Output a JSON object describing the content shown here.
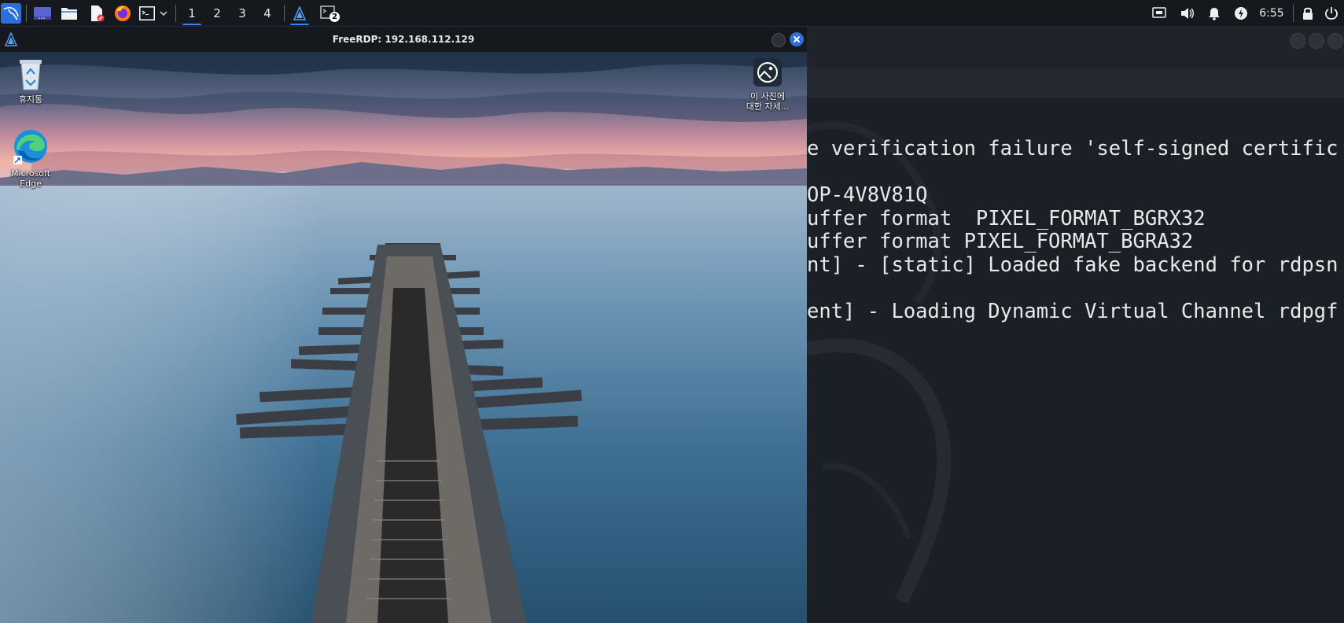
{
  "taskbar": {
    "workspaces": [
      "1",
      "2",
      "3",
      "4"
    ],
    "active_workspace": "1",
    "terminal_badge": "2",
    "clock": "6:55",
    "icons": [
      "kali-menu-icon",
      "show-desktop-icon",
      "file-manager-icon",
      "text-editor-icon",
      "firefox-icon",
      "terminal-icon",
      "chevron-down-icon",
      "freerdp-task-icon",
      "terminal-task-icon",
      "display-icon",
      "volume-icon",
      "notification-bell-icon",
      "power-manager-icon",
      "lock-icon",
      "power-icon"
    ]
  },
  "rdp_window": {
    "title": "FreeRDP: 192.168.112.129",
    "desktop_icons": [
      {
        "name": "recycle-bin",
        "label": "휴지통"
      },
      {
        "name": "microsoft-edge",
        "label_line1": "Microsoft",
        "label_line2": "Edge"
      },
      {
        "name": "learn-about-picture",
        "label_line1": "이 사진에",
        "label_line2": "대한 자세..."
      }
    ]
  },
  "terminal": {
    "lines": [
      "e verification failure 'self-signed certific",
      "",
      "OP-4V8V81Q",
      "uffer format  PIXEL_FORMAT_BGRX32",
      "uffer format PIXEL_FORMAT_BGRA32",
      "nt] - [static] Loaded fake backend for rdpsn",
      "",
      "ent] - Loading Dynamic Virtual Channel rdpgf"
    ]
  },
  "colors": {
    "accent": "#3b82f6",
    "close_button": "#2f6fd8",
    "panel_bg": "#15181d",
    "terminal_bg": "#1b1f26"
  }
}
